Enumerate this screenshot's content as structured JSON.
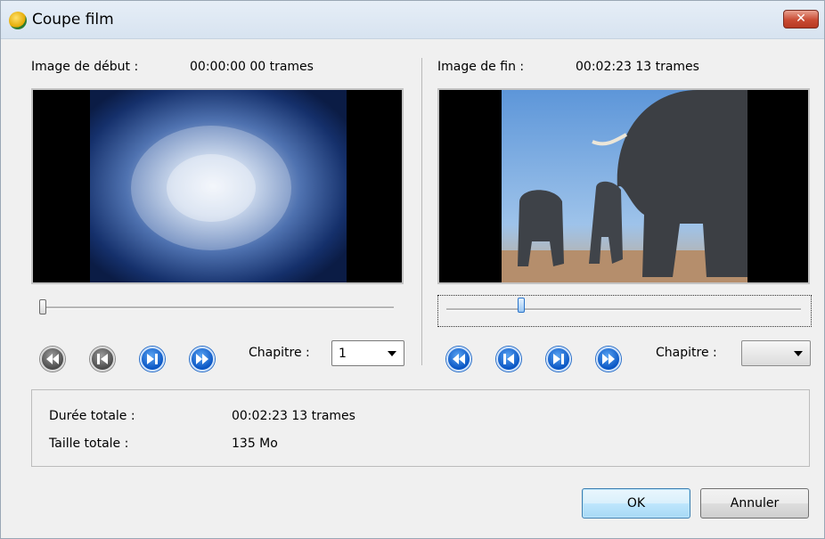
{
  "window": {
    "title": "Coupe film",
    "close_label": "✕"
  },
  "start": {
    "label": "Image de début :",
    "time": "00:00:00 00 trames",
    "slider_position": 0.0,
    "chapter_label": "Chapitre :",
    "chapter_value": "1"
  },
  "end": {
    "label": "Image de fin :",
    "time": "00:02:23 13 trames",
    "slider_position": 0.2,
    "chapter_label": "Chapitre :",
    "chapter_value": ""
  },
  "summary": {
    "duration_label": "Durée totale :",
    "duration_value": "00:02:23 13 trames",
    "size_label": "Taille totale :",
    "size_value": "135 Mo"
  },
  "buttons": {
    "ok": "OK",
    "cancel": "Annuler"
  },
  "icons": {
    "rewind": "rewind-icon",
    "step_back": "step-back-icon",
    "step_forward": "step-forward-icon",
    "fast_forward": "fast-forward-icon"
  },
  "colors": {
    "active_button": "#0a56c4",
    "disabled_button": "#4b4b4b"
  }
}
